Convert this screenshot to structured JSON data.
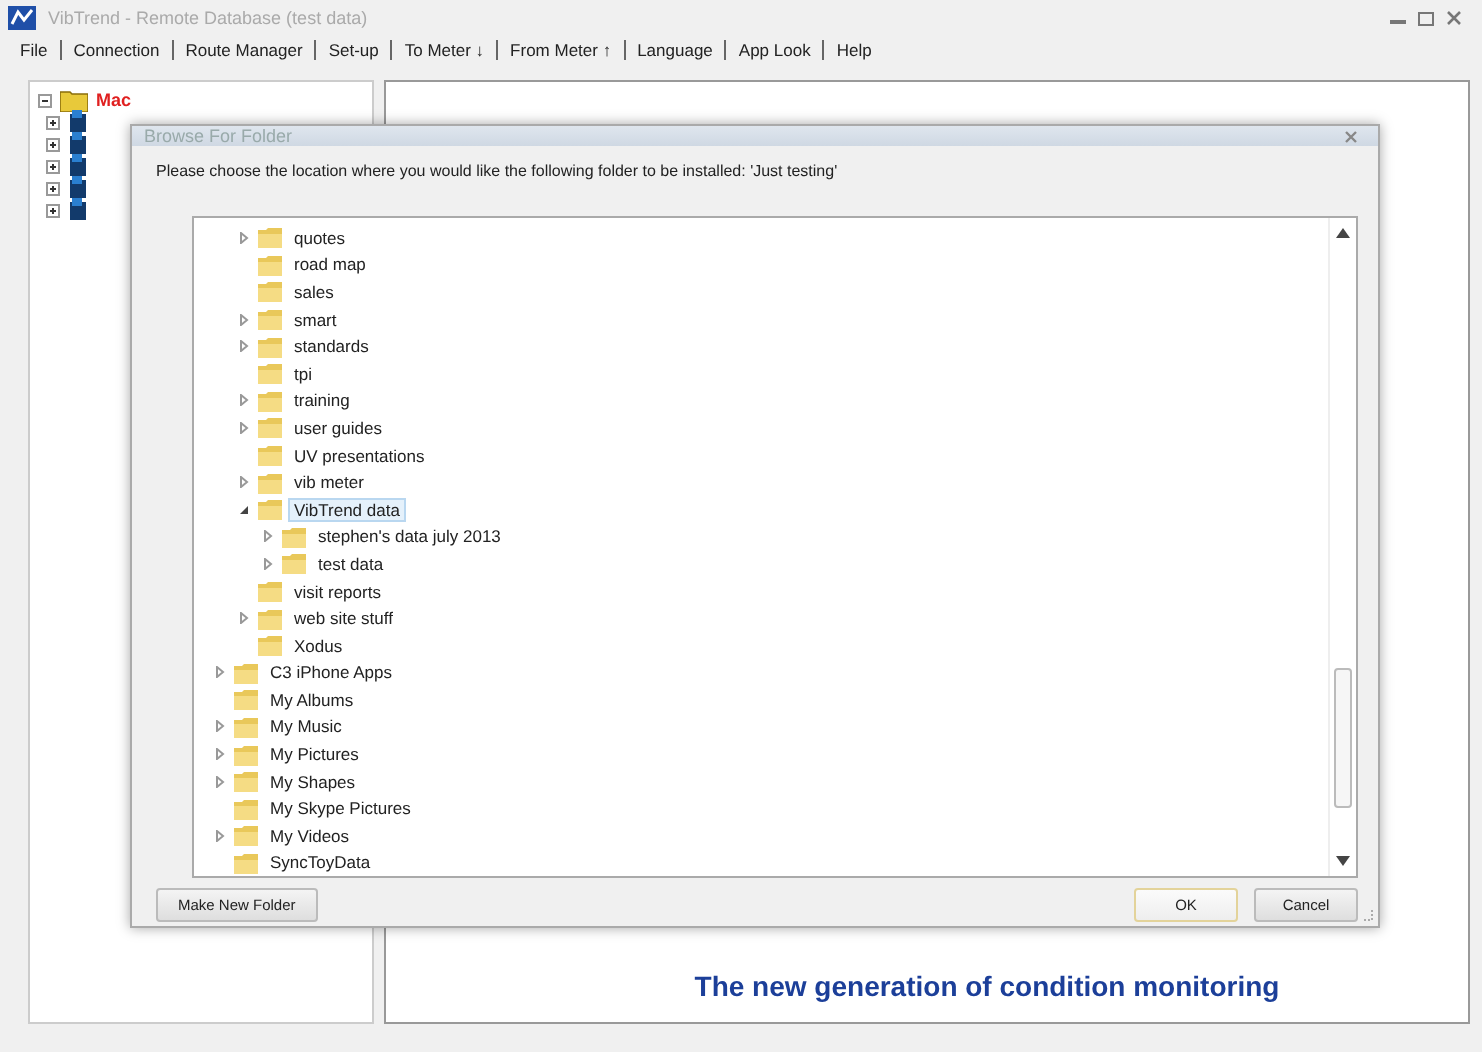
{
  "window": {
    "title": "VibTrend - Remote Database (test data)"
  },
  "menu": [
    "File",
    "Connection",
    "Route Manager",
    "Set-up",
    "To Meter ↓",
    "From Meter ↑",
    "Language",
    "App Look",
    "Help"
  ],
  "machine_tree": {
    "root": {
      "label": "Mac",
      "expanded": true
    },
    "children": [
      {
        "expanded": false
      },
      {
        "expanded": false
      },
      {
        "expanded": false
      },
      {
        "expanded": false
      },
      {
        "expanded": false
      }
    ]
  },
  "slogan": "The new generation of condition monitoring",
  "dialog": {
    "title": "Browse For Folder",
    "prompt": "Please choose the location where you would like the following folder to be installed: 'Just testing'",
    "folder_tree": {
      "items": [
        {
          "label": "quotes",
          "expandable": true,
          "expanded": false,
          "selected": false
        },
        {
          "label": "road map",
          "expandable": false,
          "selected": false
        },
        {
          "label": "sales",
          "expandable": false,
          "selected": false
        },
        {
          "label": "smart",
          "expandable": true,
          "expanded": false,
          "selected": false
        },
        {
          "label": "standards",
          "expandable": true,
          "expanded": false,
          "selected": false
        },
        {
          "label": "tpi",
          "expandable": false,
          "selected": false
        },
        {
          "label": "training",
          "expandable": true,
          "expanded": false,
          "selected": false
        },
        {
          "label": "user guides",
          "expandable": true,
          "expanded": false,
          "selected": false
        },
        {
          "label": "UV presentations",
          "expandable": false,
          "selected": false
        },
        {
          "label": "vib meter",
          "expandable": true,
          "expanded": false,
          "selected": false
        },
        {
          "label": "VibTrend data",
          "expandable": true,
          "expanded": true,
          "selected": true,
          "children": [
            {
              "label": "stephen's data july 2013",
              "expandable": true,
              "expanded": false,
              "selected": false
            },
            {
              "label": "test data",
              "expandable": true,
              "expanded": false,
              "selected": false
            }
          ]
        },
        {
          "label": "visit reports",
          "expandable": false,
          "selected": false
        },
        {
          "label": "web site stuff",
          "expandable": true,
          "expanded": false,
          "selected": false
        },
        {
          "label": "Xodus",
          "expandable": false,
          "selected": false
        }
      ],
      "parent_siblings": [
        {
          "label": "C3 iPhone Apps",
          "expandable": true,
          "expanded": false,
          "selected": false
        },
        {
          "label": "My Albums",
          "expandable": false,
          "selected": false
        },
        {
          "label": "My Music",
          "expandable": true,
          "expanded": false,
          "selected": false
        },
        {
          "label": "My Pictures",
          "expandable": true,
          "expanded": false,
          "selected": false
        },
        {
          "label": "My Shapes",
          "expandable": true,
          "expanded": false,
          "selected": false
        },
        {
          "label": "My Skype Pictures",
          "expandable": false,
          "selected": false
        },
        {
          "label": "My Videos",
          "expandable": true,
          "expanded": false,
          "selected": false
        },
        {
          "label": "SyncToyData",
          "expandable": false,
          "selected": false
        }
      ]
    },
    "buttons": {
      "new_folder": "Make New Folder",
      "ok": "OK",
      "cancel": "Cancel"
    }
  }
}
